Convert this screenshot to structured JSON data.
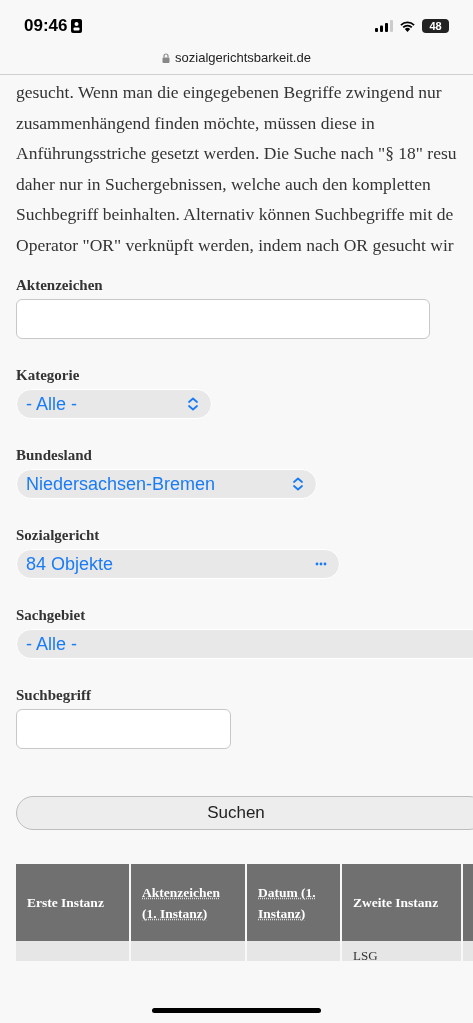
{
  "status_bar": {
    "time": "09:46",
    "battery": "48"
  },
  "address_bar": {
    "url": "sozialgerichtsbarkeit.de"
  },
  "intro_lines": [
    "gesucht. Wenn man die eingegebenen Begriffe zwingend nur",
    "zusammenhängend finden möchte, müssen diese in",
    "Anführungsstriche gesetzt werden. Die Suche nach \"§ 18\" resu",
    "daher nur in Suchergebnissen, welche auch den kompletten",
    "Suchbegriff beinhalten. Alternativ können Suchbegriffe mit de",
    "Operator \"OR\" verknüpft werden, indem nach OR gesucht wir"
  ],
  "fields": [
    {
      "label": "Aktenzeichen",
      "kind": "text"
    },
    {
      "label": "Kategorie",
      "kind": "select",
      "value": "- Alle -"
    },
    {
      "label": "Bundesland",
      "kind": "select",
      "value": "Niedersachsen-Bremen"
    },
    {
      "label": "Sozialgericht",
      "kind": "select",
      "value": "84 Objekte"
    },
    {
      "label": "Sachgebiet",
      "kind": "select",
      "value": "- Alle -"
    },
    {
      "label": "Suchbegriff",
      "kind": "text"
    }
  ],
  "search_button": "Suchen",
  "table": {
    "columns": [
      {
        "label": "Erste Instanz",
        "kind": "plain"
      },
      {
        "label": "Aktenzeichen (1. Instanz)",
        "kind": "link"
      },
      {
        "label": "Datum (1. Instanz)",
        "kind": "link"
      },
      {
        "label": "Zweite Instanz",
        "kind": "plain"
      }
    ],
    "rows": [
      [
        "",
        "",
        "",
        "LSG"
      ]
    ]
  }
}
